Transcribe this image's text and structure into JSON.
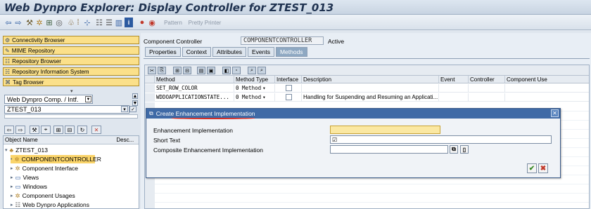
{
  "window": {
    "title": "Web Dynpro Explorer: Display Controller for ZTEST_013"
  },
  "toolbar": {
    "pattern_label": "Pattern",
    "pretty_printer_label": "Pretty Printer"
  },
  "nav": {
    "buttons": [
      {
        "label": "Connectivity Browser"
      },
      {
        "label": "MIME Repository"
      },
      {
        "label": "Repository Browser"
      },
      {
        "label": "Repository Information System"
      },
      {
        "label": "Tag Browser"
      }
    ],
    "object_type": "Web Dynpro Comp. / Intf.",
    "object_name": "ZTEST_013"
  },
  "tree": {
    "headers": [
      "Object Name",
      "Desc..."
    ],
    "items": [
      {
        "label": "ZTEST_013"
      },
      {
        "label": "COMPONENTCONTROLLER"
      },
      {
        "label": "Component Interface"
      },
      {
        "label": "Views"
      },
      {
        "label": "Windows"
      },
      {
        "label": "Component Usages"
      },
      {
        "label": "Web Dynpro Applications"
      }
    ]
  },
  "main": {
    "controller_label": "Component Controller",
    "controller_value": "COMPONENTCONTROLLER",
    "status": "Active",
    "tabs": [
      "Properties",
      "Context",
      "Attributes",
      "Events",
      "Methods"
    ],
    "active_tab": "Methods"
  },
  "table": {
    "columns": [
      "Method",
      "Method Type",
      "Interface",
      "Description",
      "Event",
      "Controller",
      "Component Use"
    ],
    "rows": [
      {
        "method": "SET_ROW_COLOR",
        "type": "0 Method",
        "description": ""
      },
      {
        "method": "WDDOAPPLICATIONSTATE...",
        "type": "0 Method",
        "description": "Handling for Suspending and Resuming an Applicati..."
      }
    ]
  },
  "dialog": {
    "title": "Create Enhancement Implementation",
    "fields": [
      {
        "label": "Enhancement Implementation",
        "value": ""
      },
      {
        "label": "Short Text",
        "value": ""
      },
      {
        "label": "Composite Enhancement Implementation",
        "value": ""
      }
    ]
  }
}
